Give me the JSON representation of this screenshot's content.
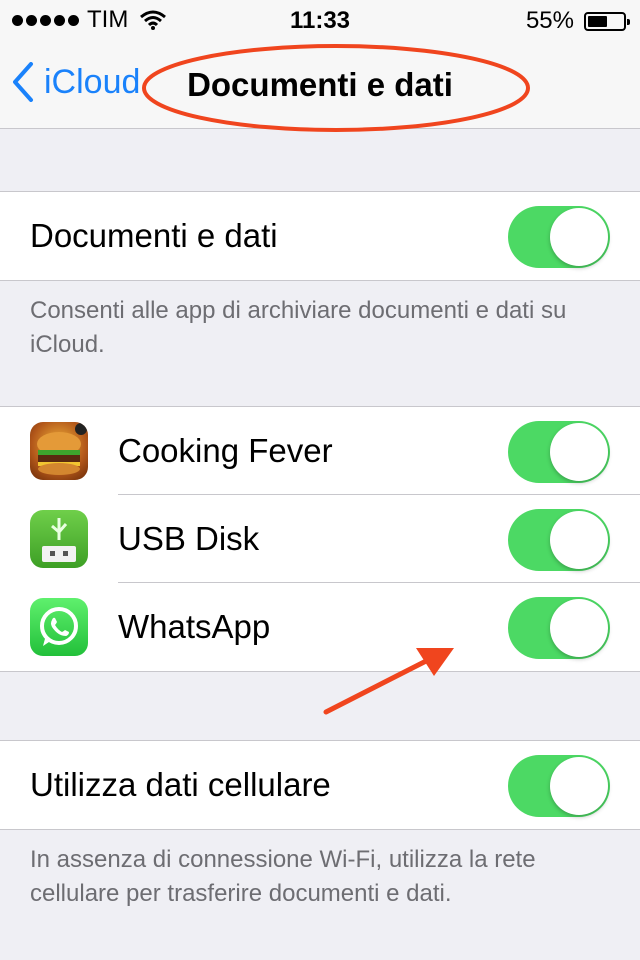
{
  "status_bar": {
    "carrier": "TIM",
    "time": "11:33",
    "battery_percent": "55%",
    "battery_level": 0.55,
    "signal_icon": "signal-dots-icon",
    "wifi_icon": "wifi-icon"
  },
  "nav": {
    "back_label": "iCloud",
    "title": "Documenti e dati"
  },
  "section1": {
    "row_label": "Documenti e dati",
    "toggle_on": true,
    "footer": "Consenti alle app di archiviare documenti e dati su iCloud."
  },
  "apps": [
    {
      "name": "Cooking Fever",
      "icon": "cooking-fever-icon",
      "toggle_on": true
    },
    {
      "name": "USB Disk",
      "icon": "usb-disk-icon",
      "toggle_on": true
    },
    {
      "name": "WhatsApp",
      "icon": "whatsapp-icon",
      "toggle_on": true
    }
  ],
  "section3": {
    "row_label": "Utilizza dati cellulare",
    "toggle_on": true,
    "footer": "In assenza di connessione Wi-Fi, utilizza la rete cellulare per trasferire documenti e dati."
  },
  "colors": {
    "accent": "#1a82fb",
    "toggle_on": "#4cd964",
    "annotation": "#f0451e"
  }
}
